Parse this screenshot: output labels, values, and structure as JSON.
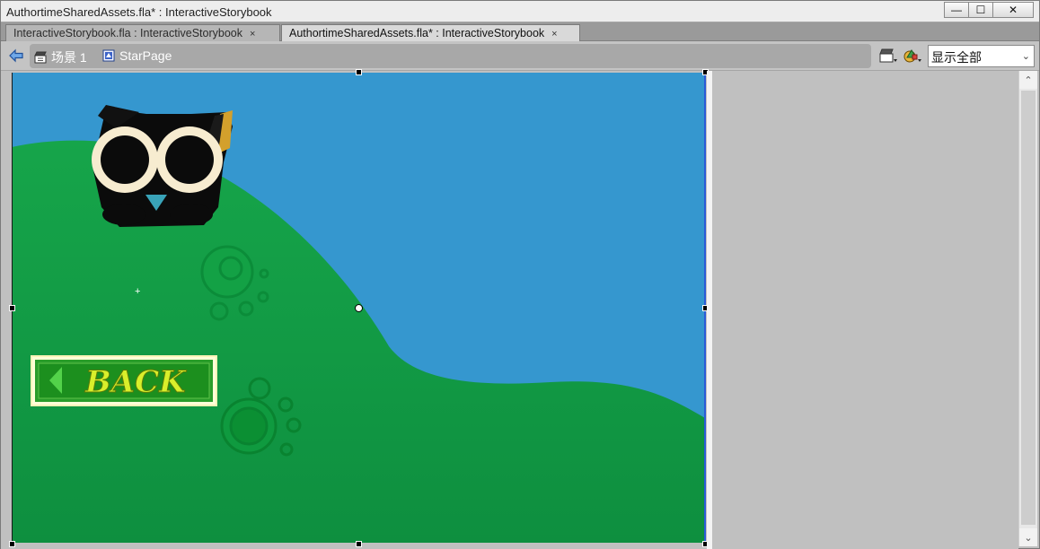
{
  "window": {
    "title": "AuthortimeSharedAssets.fla* : InteractiveStorybook",
    "controls": {
      "minimize": "—",
      "maximize": "☐",
      "close": "✕"
    }
  },
  "tabs": [
    {
      "label": "InteractiveStorybook.fla : InteractiveStorybook",
      "close": "×",
      "active": false
    },
    {
      "label": "AuthortimeSharedAssets.fla* : InteractiveStorybook",
      "close": "×",
      "active": true
    }
  ],
  "editbar": {
    "breadcrumbs": [
      {
        "label": "场景 1",
        "icon": "scene-clapper-icon"
      },
      {
        "label": "StarPage",
        "icon": "movieclip-symbol-icon"
      }
    ],
    "zoom": {
      "selected": "显示全部"
    },
    "tools": [
      "edit-scene-icon",
      "edit-symbols-icon"
    ]
  },
  "stage": {
    "sky_color": "#3597cf",
    "hill_color": "#12a146",
    "back_button": {
      "text": "BACK"
    },
    "character": "black-cat-icon"
  },
  "scrollbar": {
    "up": "⌃",
    "down": "⌄"
  }
}
